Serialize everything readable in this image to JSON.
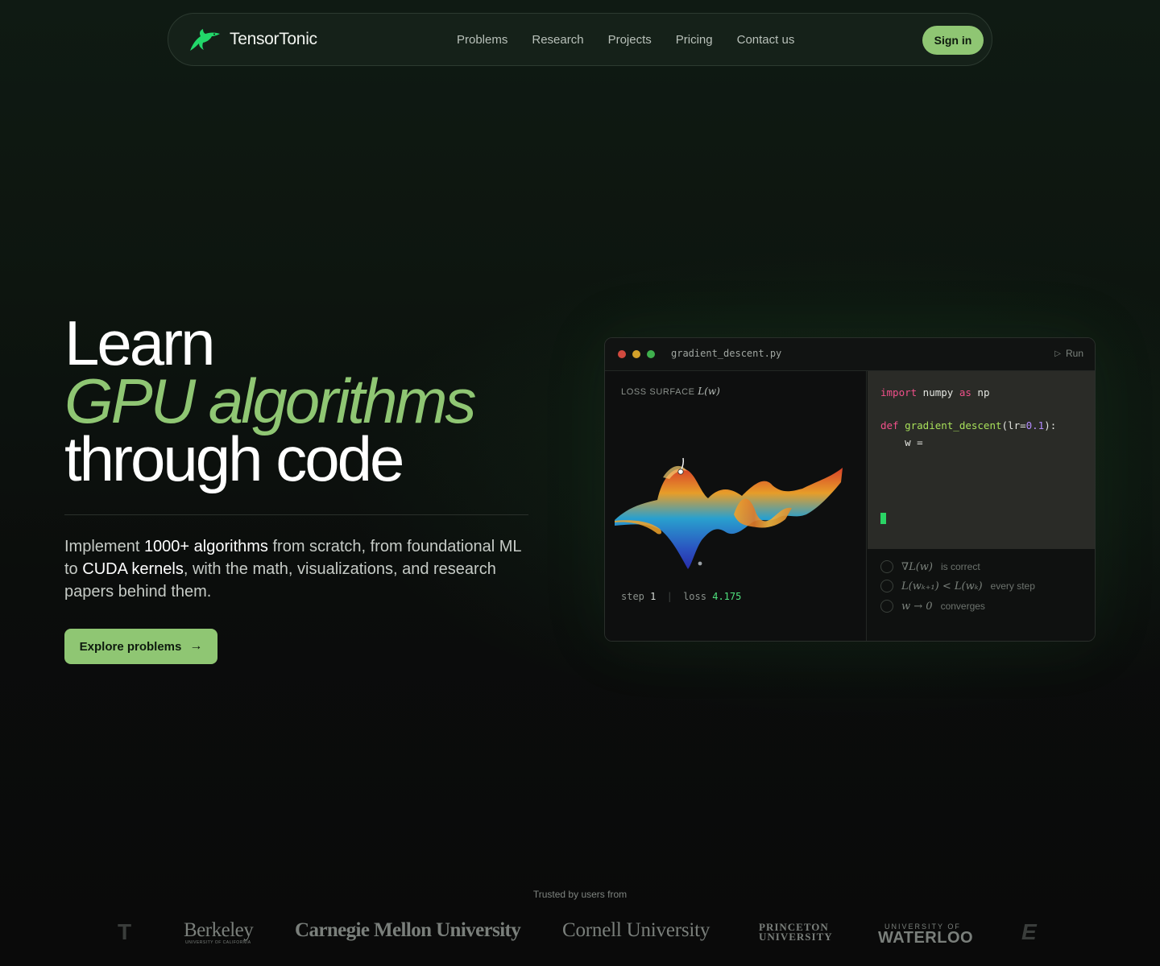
{
  "nav": {
    "brand": "TensorTonic",
    "links": [
      "Problems",
      "Research",
      "Projects",
      "Pricing",
      "Contact us"
    ],
    "sign_in": "Sign in"
  },
  "hero": {
    "title_line1": "Learn",
    "title_line2": "GPU algorithms",
    "title_line3": "through code",
    "sub_1": "Implement ",
    "sub_bold_1": "1000+ algorithms",
    "sub_2": " from scratch, from foundational ML to ",
    "sub_bold_2": "CUDA kernels",
    "sub_3": ", with the math, visualizations, and research papers behind them.",
    "cta": "Explore problems",
    "cta_icon": "arrow-right-icon"
  },
  "editor": {
    "filename": "gradient_descent.py",
    "run_label": "Run",
    "run_icon": "play-icon",
    "viz_label": "LOSS SURFACE",
    "viz_label_math": "L(w)",
    "status": {
      "step_label": "step",
      "step_value": "1",
      "separator": "|",
      "loss_label": "loss",
      "loss_value": "4.175"
    },
    "code": {
      "line1_kw1": "import",
      "line1_mod": " numpy ",
      "line1_kw2": "as",
      "line1_alias": " np",
      "line2_kw": "def",
      "line2_fn": " gradient_descent",
      "line2_open": "(lr=",
      "line2_num": "0.1",
      "line2_close": "):",
      "line3": "    w ="
    },
    "checks": [
      {
        "math": "∇L(w)",
        "text": "is correct"
      },
      {
        "math": "L(wₖ₊₁) < L(wₖ)",
        "text": "every step"
      },
      {
        "math": "w → 0",
        "text": "converges"
      }
    ]
  },
  "trusted": {
    "title": "Trusted by users from",
    "logos": {
      "berkeley": "Berkeley",
      "berkeley_sub": "UNIVERSITY OF CALIFORNIA",
      "cmu": "Carnegie Mellon University",
      "cornell": "Cornell University",
      "princeton_1": "PRINCETON",
      "princeton_2": "UNIVERSITY",
      "waterloo_top": "UNIVERSITY OF",
      "waterloo": "WATERLOO"
    }
  },
  "colors": {
    "accent": "#8fc673",
    "loss_value": "#4fe07d",
    "keyword": "#f0508a",
    "function": "#a8e05a",
    "number": "#b48cff"
  }
}
